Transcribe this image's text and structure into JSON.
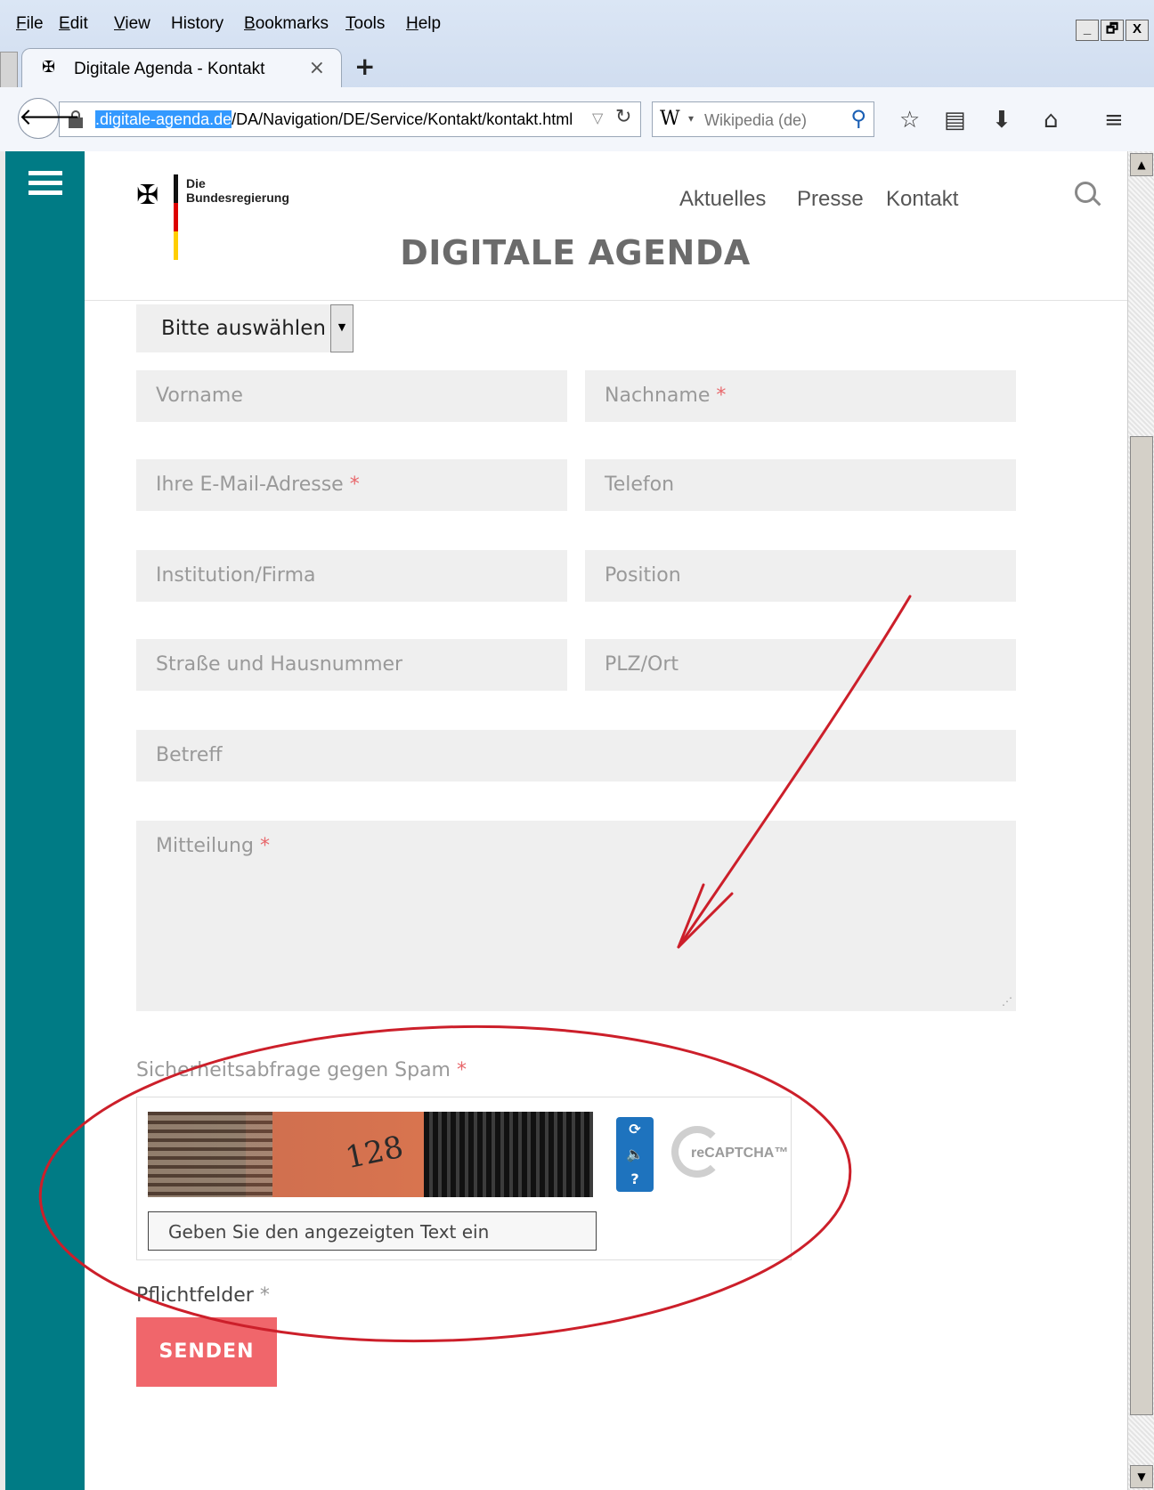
{
  "menubar": {
    "items": [
      {
        "key": "F",
        "rest": "ile"
      },
      {
        "key": "E",
        "rest": "dit"
      },
      {
        "key": "V",
        "rest": "iew"
      },
      {
        "key": "",
        "rest": "History"
      },
      {
        "key": "B",
        "rest": "ookmarks"
      },
      {
        "key": "T",
        "rest": "ools"
      },
      {
        "key": "H",
        "rest": "elp"
      }
    ]
  },
  "window_buttons": {
    "minimize": "_",
    "restore": "🗗",
    "close": "X"
  },
  "tab": {
    "title": "Digitale Agenda - Kontakt",
    "close": "×",
    "new_tab": "+"
  },
  "urlbar": {
    "highlighted": ".digitale-agenda.de",
    "rest": "/DA/Navigation/DE/Service/Kontakt/kontakt.html"
  },
  "searchbar": {
    "engine_glyph": "W",
    "placeholder": "Wikipedia (de)"
  },
  "icons": {
    "back": "back-arrow-icon",
    "lock": "lock-icon",
    "reload": "reload-icon",
    "search": "magnifier-icon",
    "bookmark": "star-icon",
    "reading_list": "clipboard-icon",
    "downloads": "download-arrow-icon",
    "home": "home-icon",
    "menu": "hamburger-icon"
  },
  "site": {
    "logo_line1": "Die",
    "logo_line2": "Bundesregierung",
    "nav": [
      "Aktuelles",
      "Presse",
      "Kontakt"
    ],
    "title": "DIGITALE AGENDA"
  },
  "form": {
    "select_value": "Bitte auswählen",
    "fields": {
      "vorname": "Vorname",
      "nachname": "Nachname",
      "email": "Ihre E-Mail-Adresse",
      "telefon": "Telefon",
      "institution": "Institution/Firma",
      "position": "Position",
      "strasse": "Straße und Hausnummer",
      "plz": "PLZ/Ort",
      "betreff": "Betreff",
      "mitteilung": "Mitteilung"
    },
    "required_mark": "*",
    "captcha_label": "Sicherheitsabfrage gegen Spam",
    "captcha_number": "128",
    "captcha_input_placeholder": "Geben Sie den angezeigten Text ein",
    "recaptcha_brand": "reCAPTCHA™",
    "required_note": "Pflichtfelder",
    "submit": "SENDEN"
  },
  "colors": {
    "rail": "#007b85",
    "submit": "#f0666b",
    "required": "#e8676b",
    "annotation": "#cc1f2a"
  }
}
